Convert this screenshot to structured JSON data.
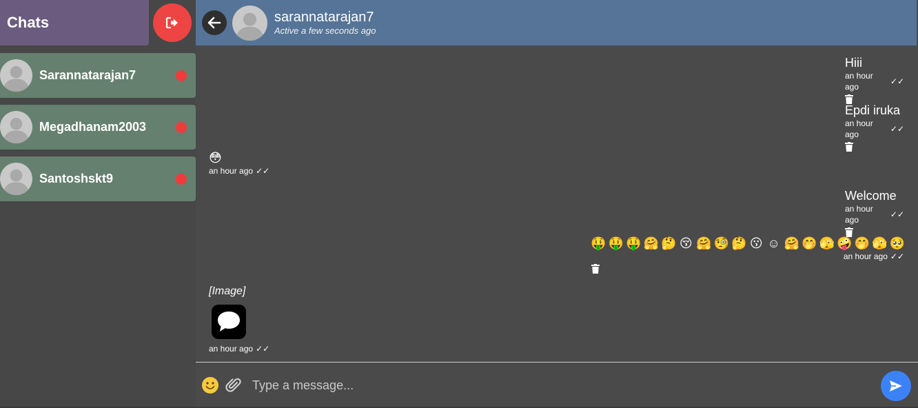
{
  "sidebar": {
    "title": "Chats",
    "logout_icon": "logout-icon",
    "contacts": [
      {
        "name": "Sarannatarajan7",
        "status_color": "#ef3b3b"
      },
      {
        "name": "Megadhanam2003",
        "status_color": "#ef3b3b"
      },
      {
        "name": "Santoshskt9",
        "status_color": "#ef3b3b"
      }
    ]
  },
  "header": {
    "name": "sarannatarajan7",
    "status": "Active a few seconds ago"
  },
  "messages": [
    {
      "side": "right",
      "text": "Hiii",
      "time": "an hour ago",
      "ticks": "✓✓"
    },
    {
      "side": "right",
      "text": "Epdi iruka",
      "time": "an hour ago",
      "ticks": "✓✓"
    },
    {
      "side": "left",
      "text": "😳",
      "time": "an hour ago",
      "ticks": "✓✓"
    },
    {
      "side": "right",
      "text": "Welcome",
      "time": "an hour ago",
      "ticks": "✓✓"
    },
    {
      "side": "right",
      "emojis": [
        "🤑",
        "🤑",
        "🤑",
        "🤗",
        "🤔",
        "😚",
        "🤗",
        "🧐",
        "🤔",
        "😗",
        "☺",
        "🤗",
        "🤭",
        "🫣",
        "🤪",
        "🤭",
        "🫣",
        "🥺"
      ],
      "time": "an hour ago",
      "ticks": "✓✓"
    },
    {
      "side": "left",
      "text": "[Image]",
      "time": "an hour ago",
      "ticks": "✓✓"
    }
  ],
  "input": {
    "placeholder": "Type a message..."
  },
  "colors": {
    "sidebar_header": "#6b5b7e",
    "chat_header": "#557497",
    "contact_bg": "#65806f",
    "logout": "#ef4444",
    "send": "#3b82f6",
    "background": "#4a4a4a"
  }
}
